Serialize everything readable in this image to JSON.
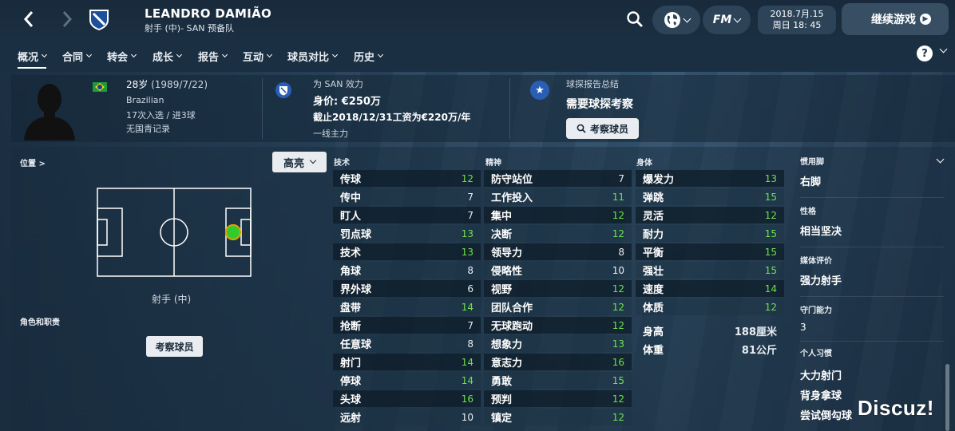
{
  "header": {
    "player_name": "LEANDRO DAMIÃO",
    "player_subtitle": "射手 (中)- SAN 预备队",
    "fm_label": "FM",
    "date_line1": "2018.7月.15",
    "date_line2": "周日 18: 45",
    "continue_label": "继续游戏"
  },
  "tabs": [
    {
      "label": "概况",
      "active": true
    },
    {
      "label": "合同"
    },
    {
      "label": "转会"
    },
    {
      "label": "成长"
    },
    {
      "label": "报告"
    },
    {
      "label": "互动"
    },
    {
      "label": "球员对比"
    },
    {
      "label": "历史"
    }
  ],
  "bio": {
    "age": "28岁",
    "dob": "(1989/7/22)",
    "nationality": "Brazilian",
    "caps": "17次入选 / 进3球",
    "youth": "无国青记录"
  },
  "club": {
    "plays_for": "为 SAN 效力",
    "value": "身价: €250万",
    "contract": "截止2018/12/31工资为€220万/年",
    "status": "一线主力"
  },
  "scout": {
    "title": "球探报告总结",
    "summary": "需要球探考察",
    "button": "考察球员"
  },
  "position": {
    "label": "位置 >",
    "highlight_button": "高亮",
    "position_name": "射手 (中)",
    "roles_label": "角色和职责",
    "scout_button": "考察球员"
  },
  "columns": {
    "technical": "技术",
    "mental": "精神",
    "physical": "身体"
  },
  "technical": [
    {
      "name": "传球",
      "value": 12,
      "hi": true
    },
    {
      "name": "传中",
      "value": 7,
      "hi": false
    },
    {
      "name": "盯人",
      "value": 7,
      "hi": false
    },
    {
      "name": "罚点球",
      "value": 13,
      "hi": true
    },
    {
      "name": "技术",
      "value": 13,
      "hi": true
    },
    {
      "name": "角球",
      "value": 8,
      "hi": false
    },
    {
      "name": "界外球",
      "value": 6,
      "hi": false
    },
    {
      "name": "盘带",
      "value": 14,
      "hi": true
    },
    {
      "name": "抢断",
      "value": 7,
      "hi": false
    },
    {
      "name": "任意球",
      "value": 8,
      "hi": false
    },
    {
      "name": "射门",
      "value": 14,
      "hi": true
    },
    {
      "name": "停球",
      "value": 14,
      "hi": true
    },
    {
      "name": "头球",
      "value": 16,
      "hi": true
    },
    {
      "name": "远射",
      "value": 10,
      "hi": false
    }
  ],
  "mental": [
    {
      "name": "防守站位",
      "value": 7,
      "hi": false
    },
    {
      "name": "工作投入",
      "value": 11,
      "hi": true
    },
    {
      "name": "集中",
      "value": 12,
      "hi": true
    },
    {
      "name": "决断",
      "value": 12,
      "hi": true
    },
    {
      "name": "领导力",
      "value": 8,
      "hi": false
    },
    {
      "name": "侵略性",
      "value": 10,
      "hi": false
    },
    {
      "name": "视野",
      "value": 12,
      "hi": true
    },
    {
      "name": "团队合作",
      "value": 12,
      "hi": true
    },
    {
      "name": "无球跑动",
      "value": 12,
      "hi": true
    },
    {
      "name": "想象力",
      "value": 13,
      "hi": true
    },
    {
      "name": "意志力",
      "value": 16,
      "hi": true
    },
    {
      "name": "勇敢",
      "value": 15,
      "hi": true
    },
    {
      "name": "预判",
      "value": 12,
      "hi": true
    },
    {
      "name": "镇定",
      "value": 12,
      "hi": true
    }
  ],
  "physical": [
    {
      "name": "爆发力",
      "value": 13,
      "hi": true
    },
    {
      "name": "弹跳",
      "value": 15,
      "hi": true
    },
    {
      "name": "灵活",
      "value": 12,
      "hi": true
    },
    {
      "name": "耐力",
      "value": 15,
      "hi": true
    },
    {
      "name": "平衡",
      "value": 15,
      "hi": true
    },
    {
      "name": "强壮",
      "value": 15,
      "hi": true
    },
    {
      "name": "速度",
      "value": 14,
      "hi": true
    },
    {
      "name": "体质",
      "value": 12,
      "hi": true
    }
  ],
  "physical_extra": [
    {
      "name": "身高",
      "value": "188厘米"
    },
    {
      "name": "体重",
      "value": "81公斤"
    }
  ],
  "right_info": {
    "foot_label": "惯用脚",
    "foot_value": "右脚",
    "personality_label": "性格",
    "personality_value": "相当坚决",
    "media_label": "媒体评价",
    "media_value": "强力射手",
    "gk_label": "守门能力",
    "gk_value": "3",
    "habits_label": "个人习惯",
    "habits": [
      "大力射门",
      "背身拿球",
      "尝试倒勾球"
    ]
  },
  "watermark": "Discuz!",
  "colors": {
    "attr_green": "#6ce04c",
    "pitch_dot": "#2ecc2e",
    "accent_blue": "#2a5eb5"
  }
}
